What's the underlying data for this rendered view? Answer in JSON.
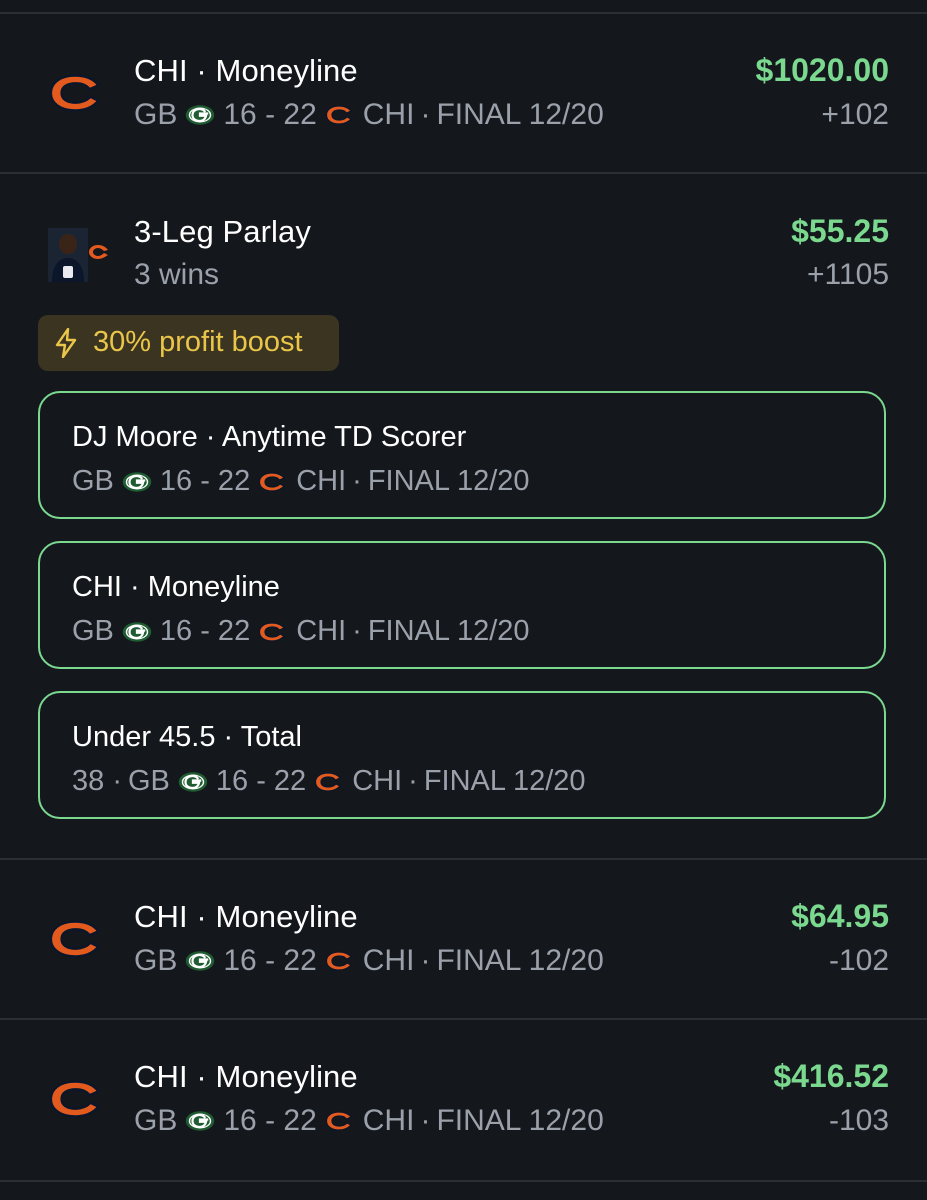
{
  "colors": {
    "background": "#14171c",
    "win_green": "#7bd88f",
    "muted": "#9ba1ab",
    "boost_bg": "#3b3420",
    "boost_text": "#e9c54a",
    "bears_orange": "#e35a1f",
    "packers_green": "#1f5c32",
    "packers_gold": "#f5c518"
  },
  "bets": [
    {
      "title": "CHI · Moneyline",
      "away": "GB",
      "score": "16 - 22",
      "home": "CHI",
      "status": "FINAL 12/20",
      "amount": "$1020.00",
      "odds": "+102",
      "icon": "bears-logo-icon"
    },
    {
      "title": "3-Leg Parlay",
      "subtitle": "3 wins",
      "amount": "$55.25",
      "odds": "+1105",
      "icon": "player-photo-icon",
      "boost": {
        "label": "30% profit boost",
        "icon": "lightning-bolt-icon"
      },
      "legs": [
        {
          "title": "DJ Moore · Anytime TD Scorer",
          "prefix": "",
          "away": "GB",
          "score": "16 - 22",
          "home": "CHI",
          "status": "FINAL 12/20"
        },
        {
          "title": "CHI · Moneyline",
          "prefix": "",
          "away": "GB",
          "score": "16 - 22",
          "home": "CHI",
          "status": "FINAL 12/20"
        },
        {
          "title": "Under 45.5 · Total",
          "prefix": "38 ·",
          "away": "GB",
          "score": "16 - 22",
          "home": "CHI",
          "status": "FINAL 12/20"
        }
      ]
    },
    {
      "title": "CHI · Moneyline",
      "away": "GB",
      "score": "16 - 22",
      "home": "CHI",
      "status": "FINAL 12/20",
      "amount": "$64.95",
      "odds": "-102",
      "icon": "bears-logo-icon"
    },
    {
      "title": "CHI · Moneyline",
      "away": "GB",
      "score": "16 - 22",
      "home": "CHI",
      "status": "FINAL 12/20",
      "amount": "$416.52",
      "odds": "-103",
      "icon": "bears-logo-icon"
    }
  ]
}
